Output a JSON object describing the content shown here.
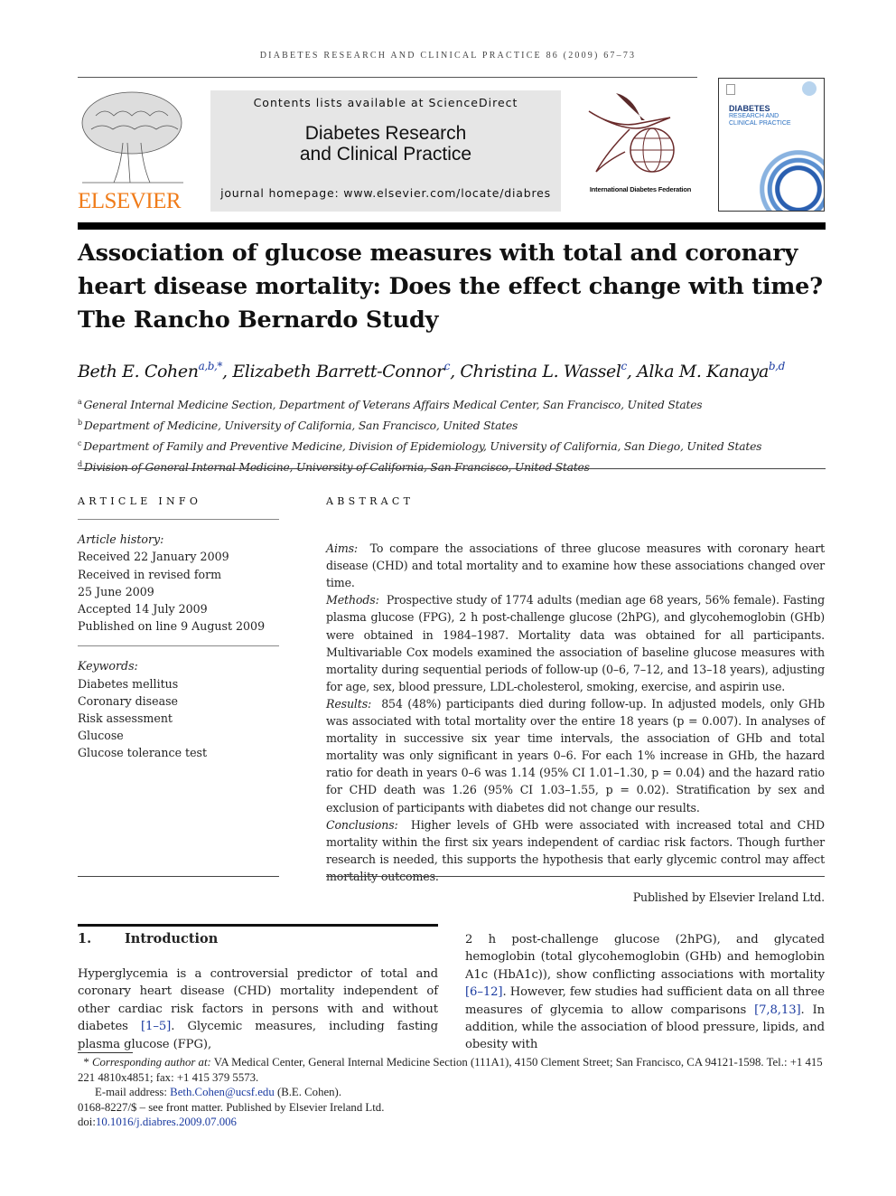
{
  "running_header": "DIABETES RESEARCH AND CLINICAL PRACTICE 86 (2009) 67–73",
  "masthead": {
    "publisher_logo": "ELSEVIER",
    "contents_line": "Contents lists available at ScienceDirect",
    "journal_title_line1": "Diabetes Research",
    "journal_title_line2": "and Clinical Practice",
    "homepage": "journal homepage: www.elsevier.com/locate/diabres",
    "idf_name": "International Diabetes Federation",
    "cover_title1": "DIABETES",
    "cover_title2": "RESEARCH AND",
    "cover_title3": "CLINICAL PRACTICE"
  },
  "title_lines": [
    "Association of glucose measures with total and coronary",
    "heart disease mortality: Does the effect change with time?",
    "The Rancho Bernardo Study"
  ],
  "authors": [
    {
      "name": "Beth E. Cohen",
      "sup": "a,b,*"
    },
    {
      "name": "Elizabeth Barrett-Connor",
      "sup": "c"
    },
    {
      "name": "Christina L. Wassel",
      "sup": "c"
    },
    {
      "name": "Alka M. Kanaya",
      "sup": "b,d"
    }
  ],
  "affiliations": [
    {
      "key": "a",
      "text": "General Internal Medicine Section, Department of Veterans Affairs Medical Center, San Francisco, United States"
    },
    {
      "key": "b",
      "text": "Department of Medicine, University of California, San Francisco, United States"
    },
    {
      "key": "c",
      "text": "Department of Family and Preventive Medicine, Division of Epidemiology, University of California, San Diego, United States"
    },
    {
      "key": "d",
      "text": "Division of General Internal Medicine, University of California, San Francisco, United States"
    }
  ],
  "article_info": {
    "heading": "ARTICLE INFO",
    "history_label": "Article history:",
    "history": [
      "Received 22 January 2009",
      "Received in revised form",
      "25 June 2009",
      "Accepted 14 July 2009",
      "Published on line 9 August 2009"
    ],
    "keywords_label": "Keywords:",
    "keywords": [
      "Diabetes mellitus",
      "Coronary disease",
      "Risk assessment",
      "Glucose",
      "Glucose tolerance test"
    ]
  },
  "abstract": {
    "heading": "ABSTRACT",
    "sections": [
      {
        "label": "Aims:",
        "text": "To compare the associations of three glucose measures with coronary heart disease (CHD) and total mortality and to examine how these associations changed over time."
      },
      {
        "label": "Methods:",
        "text": "Prospective study of 1774 adults (median age 68 years, 56% female). Fasting plasma glucose (FPG), 2 h post-challenge glucose (2hPG), and glycohemoglobin (GHb) were obtained in 1984–1987. Mortality data was obtained for all participants. Multivariable Cox models examined the association of baseline glucose measures with mortality during sequential periods of follow-up (0–6, 7–12, and 13–18 years), adjusting for age, sex, blood pressure, LDL-cholesterol, smoking, exercise, and aspirin use."
      },
      {
        "label": "Results:",
        "text": "854 (48%) participants died during follow-up. In adjusted models, only GHb was associated with total mortality over the entire 18 years (p = 0.007). In analyses of mortality in successive six year time intervals, the association of GHb and total mortality was only significant in years 0–6. For each 1% increase in GHb, the hazard ratio for death in years 0–6 was 1.14 (95% CI 1.01–1.30, p = 0.04) and the hazard ratio for CHD death was 1.26 (95% CI 1.03–1.55, p = 0.02). Stratification by sex and exclusion of participants with diabetes did not change our results."
      },
      {
        "label": "Conclusions:",
        "text": "Higher levels of GHb were associated with increased total and CHD mortality within the first six years independent of cardiac risk factors. Though further research is needed, this supports the hypothesis that early glycemic control may affect mortality outcomes."
      }
    ],
    "published_by": "Published by Elsevier Ireland Ltd."
  },
  "introduction": {
    "number": "1.",
    "heading": "Introduction",
    "left_a": "Hyperglycemia is a controversial predictor of total and coronary heart disease (CHD) mortality independent of other cardiac risk factors in persons with and without diabetes ",
    "left_ref": "[1–5]",
    "left_b": ". Glycemic measures, including fasting plasma glucose (FPG),",
    "right_a": "2 h post-challenge glucose (2hPG), and glycated hemoglobin (total glycohemoglobin (GHb) and hemoglobin A1c (HbA1c)), show conflicting associations with mortality ",
    "right_ref1": "[6–12]",
    "right_b": ". However, few studies had sufficient data on all three measures of glycemia to allow comparisons ",
    "right_ref2": "[7,8,13]",
    "right_c": ". In addition, while the association of blood pressure, lipids, and obesity with"
  },
  "footnotes": {
    "corr_label": "Corresponding author at:",
    "corr_text": "VA Medical Center, General Internal Medicine Section (111A1), 4150 Clement Street; San Francisco, CA 94121-1598. Tel.: +1 415 221 4810x4851; fax: +1 415 379 5573.",
    "email_label": "E-mail address:",
    "email": "Beth.Cohen@ucsf.edu",
    "email_suffix": "(B.E. Cohen).",
    "copyright": "0168-8227/$ – see front matter. Published by Elsevier Ireland Ltd.",
    "doi_label": "doi:",
    "doi": "10.1016/j.diabres.2009.07.006"
  }
}
